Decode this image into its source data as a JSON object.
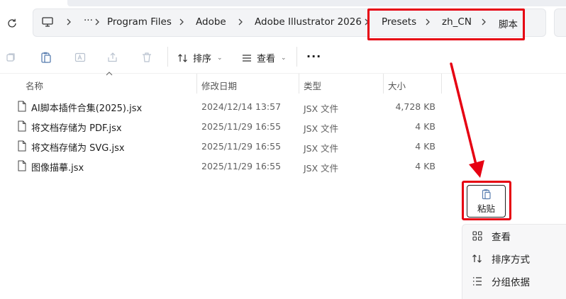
{
  "address": {
    "more": "···",
    "crumbs": [
      "Program Files",
      "Adobe",
      "Adobe Illustrator 2026",
      "Presets",
      "zh_CN",
      "脚本"
    ]
  },
  "toolbar": {
    "sort_label": "排序",
    "view_label": "查看",
    "more": "···"
  },
  "columns": {
    "name": "名称",
    "modified": "修改日期",
    "type": "类型",
    "size": "大小"
  },
  "files": [
    {
      "name": "AI脚本插件合集(2025).jsx",
      "modified": "2024/12/14 13:57",
      "type": "JSX 文件",
      "size": "4,728 KB"
    },
    {
      "name": "将文档存储为 PDF.jsx",
      "modified": "2025/11/29 16:55",
      "type": "JSX 文件",
      "size": "4 KB"
    },
    {
      "name": "将文档存储为 SVG.jsx",
      "modified": "2025/11/29 16:55",
      "type": "JSX 文件",
      "size": "4 KB"
    },
    {
      "name": "图像描摹.jsx",
      "modified": "2025/11/29 16:55",
      "type": "JSX 文件",
      "size": "4 KB"
    }
  ],
  "context_menu": {
    "paste_label": "粘贴",
    "items": [
      {
        "label": "查看",
        "icon": "grid-icon"
      },
      {
        "label": "排序方式",
        "icon": "sort-icon"
      },
      {
        "label": "分组依据",
        "icon": "group-list-icon"
      }
    ]
  },
  "colors": {
    "highlight": "#e60012",
    "accent_icon": "#5a7fb0"
  }
}
